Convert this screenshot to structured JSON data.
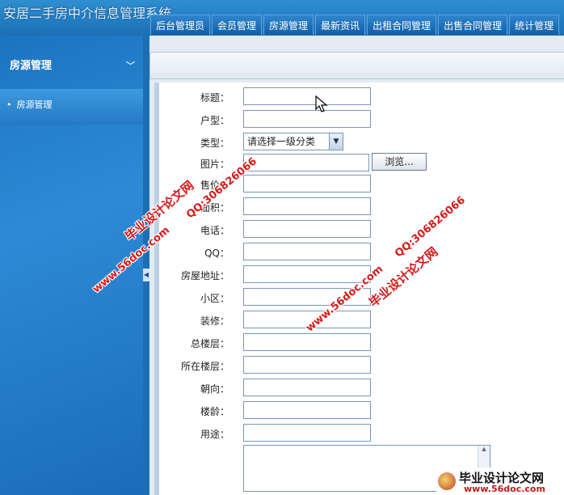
{
  "header": {
    "app_title": "安居二手房中介信息管理系统",
    "nav": [
      "后台管理员",
      "会员管理",
      "房源管理",
      "最新资讯",
      "出租合同管理",
      "出售合同管理",
      "统计管理"
    ]
  },
  "sidebar": {
    "title": "房源管理",
    "collapse_icon": "double-chevron-down-icon",
    "items": [
      {
        "label": "房源管理",
        "bullet": "•"
      }
    ]
  },
  "form": {
    "title_label": "标题：",
    "layout_label": "户型：",
    "type_label": "类型：",
    "type_selected": "请选择一级分类",
    "image_label": "图片：",
    "browse_label": "浏览...",
    "price_label": "售价：",
    "area_label": "面积：",
    "phone_label": "电话：",
    "qq_label": "QQ：",
    "address_label": "房屋地址：",
    "community_label": "小区：",
    "decoration_label": "装修：",
    "total_floors_label": "总楼层：",
    "floor_label": "所在楼层：",
    "orientation_label": "朝向：",
    "age_label": "楼龄：",
    "usage_label": "用途："
  },
  "watermarks": {
    "site": "毕业设计论文网",
    "url": "www.56doc.com",
    "qq": "QQ:306826066",
    "logo_title": "毕业设计论文网",
    "logo_url": "www.56doc.com"
  },
  "colors": {
    "accent": "#1c6fb5",
    "watermark": "#d61a1a"
  }
}
